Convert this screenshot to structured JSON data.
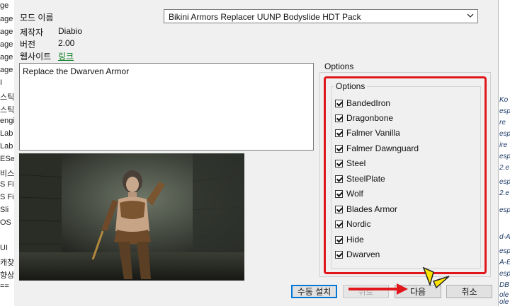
{
  "left_strip": [
    "ge",
    "age",
    "age",
    "age",
    "age",
    "age",
    "I",
    "스틱",
    "스틱",
    "engi",
    "Lab",
    "Lab",
    "ESe",
    "비스",
    "S Fi",
    "S Fi",
    "Sli",
    "OS",
    "UI",
    "캐찾",
    "향상",
    "=="
  ],
  "right_strip": [
    "Ko",
    "esp",
    "re",
    "esp",
    "ire",
    "esp",
    "2.e",
    "esp",
    "2.e",
    "esp",
    "d-A",
    "esp",
    "A-E",
    "esp",
    "DB",
    "ole",
    "ole"
  ],
  "dialog": {
    "info": {
      "mod_name_label": "모드 이름",
      "author_label": "제작자",
      "author_value": "Diabio",
      "version_label": "버전",
      "version_value": "2.00",
      "website_label": "웹사이트",
      "website_value": "링크"
    },
    "installer_select": {
      "value": "Bikini Armors Replacer UUNP Bodyslide HDT Pack"
    },
    "description": "Replace the Dwarven Armor",
    "options_group_label": "Options",
    "options_inner_label": "Options",
    "options": [
      {
        "label": "BandedIron",
        "checked": true
      },
      {
        "label": "Dragonbone",
        "checked": true
      },
      {
        "label": "Falmer Vanilla",
        "checked": true
      },
      {
        "label": "Falmer Dawnguard",
        "checked": true
      },
      {
        "label": "Steel",
        "checked": true
      },
      {
        "label": "SteelPlate",
        "checked": true
      },
      {
        "label": "Wolf",
        "checked": true
      },
      {
        "label": "Blades Armor",
        "checked": true
      },
      {
        "label": "Nordic",
        "checked": true
      },
      {
        "label": "Hide",
        "checked": true
      },
      {
        "label": "Dwarven",
        "checked": true
      }
    ],
    "buttons": {
      "manual_install": "수동 설치",
      "back": "뒤로",
      "next": "다음",
      "cancel": "취소"
    }
  },
  "colors": {
    "highlight_red": "#e0161b",
    "annotation_yellow": "#ffe500",
    "link_green": "#0a7d24"
  },
  "icons": [
    "chevron-down-icon",
    "checkbox-checked-icon",
    "red-arrow-annotation",
    "yellow-pointer-annotation"
  ]
}
